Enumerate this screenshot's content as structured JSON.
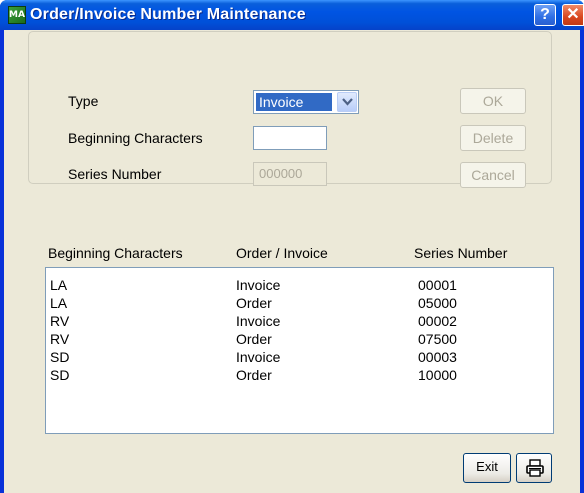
{
  "window": {
    "title": "Order/Invoice Number Maintenance",
    "app_icon_text": "MA",
    "help_label": "?",
    "close_label": "✕"
  },
  "form": {
    "type_label": "Type",
    "type_value": "Invoice",
    "beginning_label": "Beginning Characters",
    "beginning_value": "",
    "series_label": "Series Number",
    "series_value": "000000"
  },
  "buttons": {
    "ok": "OK",
    "delete": "Delete",
    "cancel": "Cancel",
    "exit": "Exit"
  },
  "list": {
    "headers": [
      "Beginning Characters",
      "Order / Invoice",
      "Series Number"
    ],
    "rows": [
      {
        "chars": "LA",
        "type": "Invoice",
        "series": "00001"
      },
      {
        "chars": "LA",
        "type": "Order",
        "series": "05000"
      },
      {
        "chars": "RV",
        "type": "Invoice",
        "series": "00002"
      },
      {
        "chars": "RV",
        "type": "Order",
        "series": "07500"
      },
      {
        "chars": "SD",
        "type": "Invoice",
        "series": "00003"
      },
      {
        "chars": "SD",
        "type": "Order",
        "series": "10000"
      }
    ]
  },
  "colors": {
    "titlebar": "#0054e3",
    "face": "#ece9d8",
    "selection": "#316ac5",
    "disabled_text": "#aca899"
  },
  "icons": {
    "app": "app-icon",
    "dropdown": "chevron-down-icon",
    "print": "printer-icon"
  }
}
